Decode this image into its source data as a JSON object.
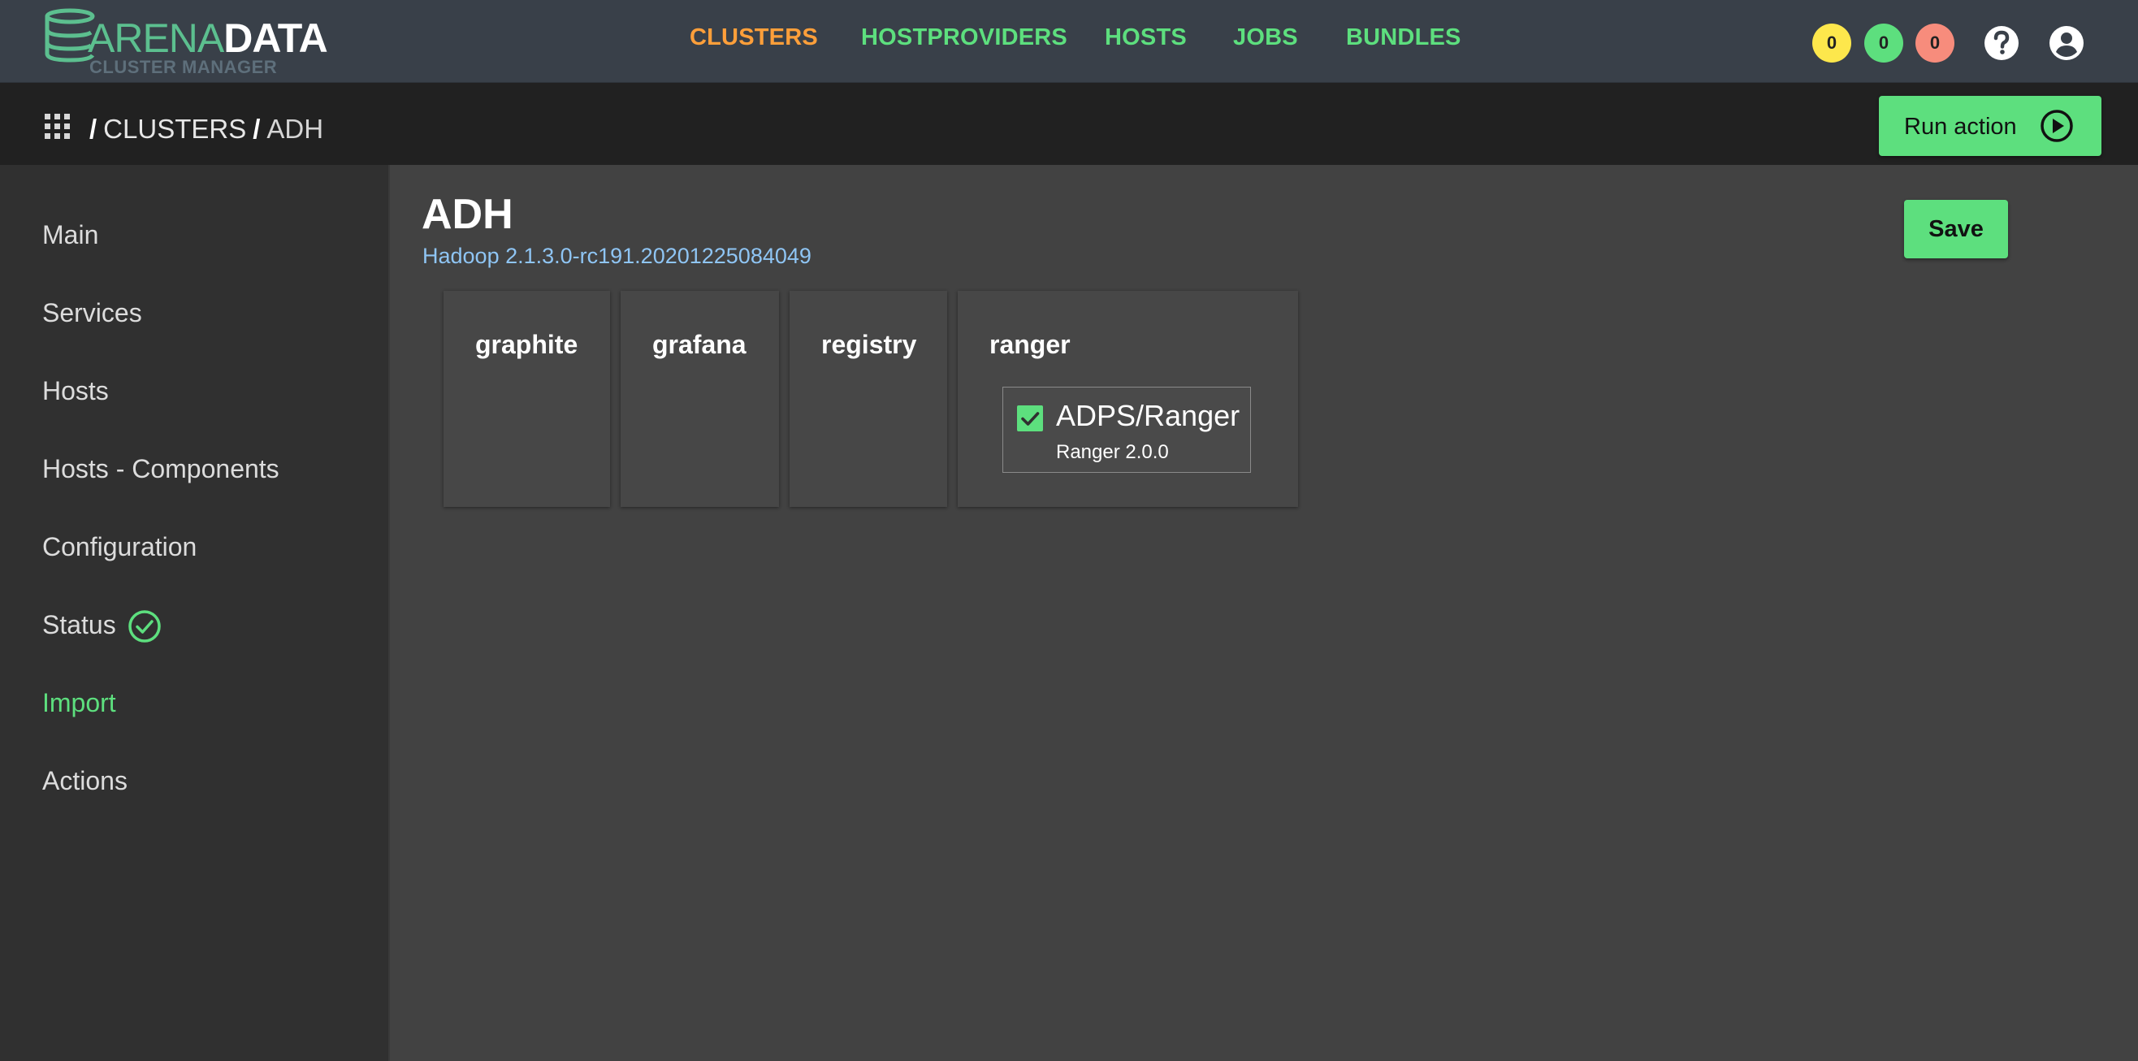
{
  "brand": {
    "name_part1": "ARENA",
    "name_part2": "DATA",
    "subtitle": "CLUSTER MANAGER"
  },
  "topnav": [
    {
      "label": "CLUSTERS",
      "active": true
    },
    {
      "label": "HOSTPROVIDERS",
      "active": false
    },
    {
      "label": "HOSTS",
      "active": false
    },
    {
      "label": "JOBS",
      "active": false
    },
    {
      "label": "BUNDLES",
      "active": false
    }
  ],
  "badges": [
    {
      "value": "0",
      "color": "#fde74c"
    },
    {
      "value": "0",
      "color": "#5ddf7e"
    },
    {
      "value": "0",
      "color": "#f78c7c"
    }
  ],
  "header_icons": {
    "help": "help-icon",
    "account": "account-icon"
  },
  "breadcrumb": {
    "icon": "apps-grid-icon",
    "separator": "/",
    "items": [
      "CLUSTERS",
      "ADH"
    ]
  },
  "actions": {
    "run_action_label": "Run action",
    "save_label": "Save"
  },
  "sidebar": {
    "items": [
      {
        "label": "Main"
      },
      {
        "label": "Services"
      },
      {
        "label": "Hosts"
      },
      {
        "label": "Hosts - Components"
      },
      {
        "label": "Configuration"
      },
      {
        "label": "Status",
        "status_icon": "check-circle-icon"
      },
      {
        "label": "Import",
        "active": true
      },
      {
        "label": "Actions"
      }
    ]
  },
  "main": {
    "title": "ADH",
    "subtitle": "Hadoop 2.1.3.0-rc191.20201225084049",
    "import_cards": [
      {
        "title": "graphite",
        "items": []
      },
      {
        "title": "grafana",
        "items": []
      },
      {
        "title": "registry",
        "items": []
      },
      {
        "title": "ranger",
        "items": [
          {
            "name": "ADPS/Ranger",
            "version": "Ranger 2.0.0",
            "checked": true
          }
        ]
      }
    ]
  },
  "colors": {
    "accent": "#5ddf7e",
    "active_nav": "#ff9f3a",
    "link": "#8fc5f4",
    "header_bg": "#394049",
    "breadcrumb_bg": "#212121",
    "sidebar_bg": "#303030",
    "content_bg": "#424242"
  }
}
